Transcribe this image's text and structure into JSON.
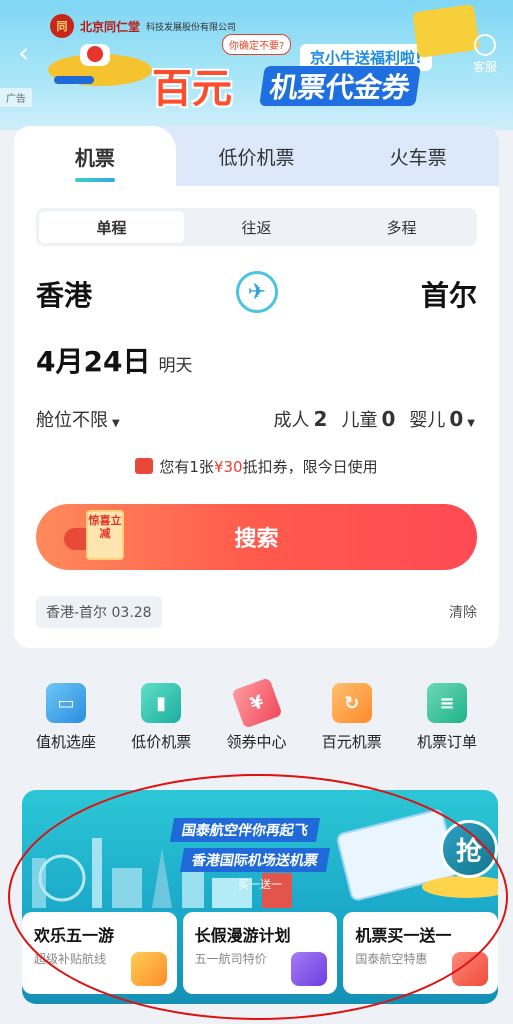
{
  "banner": {
    "brand_name": "北京同仁堂",
    "brand_company": "科技发展股份有限公司",
    "seal_text": "同",
    "bubble_text": "你确定不要?",
    "jingxiaoniu": "京小牛送福利啦!",
    "hundred": "百元",
    "coupon_text": "机票代金券",
    "ad_tag": "广告",
    "back_icon": "‹",
    "service_label": "客服"
  },
  "tabs": [
    {
      "label": "机票"
    },
    {
      "label": "低价机票"
    },
    {
      "label": "火车票"
    }
  ],
  "trip_types": [
    {
      "label": "单程"
    },
    {
      "label": "往返"
    },
    {
      "label": "多程"
    }
  ],
  "route": {
    "from": "香港",
    "to": "首尔",
    "swap_icon": "✈"
  },
  "date": {
    "value": "4月24日",
    "note": "明天"
  },
  "cabin": {
    "label": "舱位不限",
    "caret": "▼"
  },
  "passengers": {
    "adult_label": "成人",
    "adult_count": "2",
    "child_label": "儿童",
    "child_count": "0",
    "infant_label": "婴儿",
    "infant_count": "0",
    "caret": "▼"
  },
  "voucher": {
    "prefix": "您有1张",
    "amount": "¥30",
    "suffix": "抵扣券，限今日使用"
  },
  "search": {
    "label": "搜索",
    "gift_label": "惊喜立减"
  },
  "history": {
    "item": "香港-首尔 03.28",
    "clear_label": "清除"
  },
  "menu": [
    {
      "label": "值机选座",
      "icon": "seat-icon"
    },
    {
      "label": "低价机票",
      "icon": "wallet-icon"
    },
    {
      "label": "领券中心",
      "icon": "coupon-tag-icon"
    },
    {
      "label": "百元机票",
      "icon": "ticket-icon"
    },
    {
      "label": "机票订单",
      "icon": "order-icon"
    }
  ],
  "promo": {
    "headline1": "国泰航空伴你再起飞",
    "headline2": "香港国际机场送机票",
    "bogo": "买一送一",
    "grab_label": "抢",
    "cards": [
      {
        "title": "欢乐五一游",
        "subtitle": "超级补贴航线"
      },
      {
        "title": "长假漫游计划",
        "subtitle": "五一航司特价"
      },
      {
        "title": "机票买一送一",
        "subtitle": "国泰航空特惠"
      }
    ]
  },
  "colors": {
    "accent_red": "#ff4a55",
    "tab_bg": "#dbe9fb",
    "promo_teal": "#1aa7c8"
  }
}
